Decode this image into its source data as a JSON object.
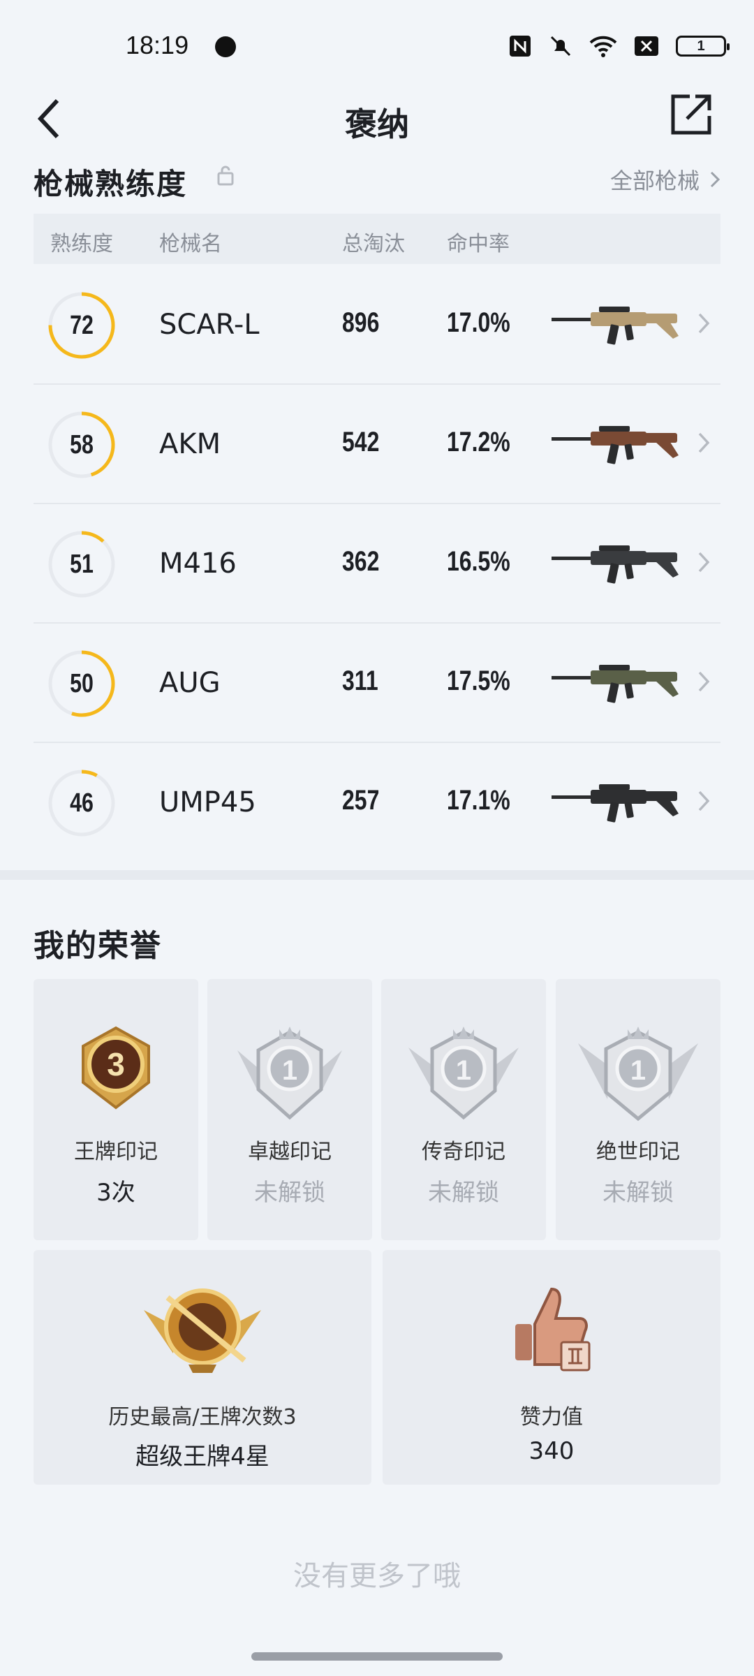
{
  "status_bar": {
    "time": "18:19",
    "battery": "1"
  },
  "header": {
    "title": "褒纳"
  },
  "weapons": {
    "title": "枪械熟练度",
    "see_all": "全部枪械",
    "columns": [
      "熟练度",
      "枪械名",
      "总淘汰",
      "命中率"
    ],
    "rows": [
      {
        "level": "72",
        "progress": 0.75,
        "name": "SCAR-L",
        "kills": "896",
        "accuracy": "17.0%",
        "gun_color": "#b59c73"
      },
      {
        "level": "58",
        "progress": 0.45,
        "name": "AKM",
        "kills": "542",
        "accuracy": "17.2%",
        "gun_color": "#7a4a34"
      },
      {
        "level": "51",
        "progress": 0.12,
        "name": "M416",
        "kills": "362",
        "accuracy": "16.5%",
        "gun_color": "#3a3c3f"
      },
      {
        "level": "50",
        "progress": 0.55,
        "name": "AUG",
        "kills": "311",
        "accuracy": "17.5%",
        "gun_color": "#5a6048"
      },
      {
        "level": "46",
        "progress": 0.08,
        "name": "UMP45",
        "kills": "257",
        "accuracy": "17.1%",
        "gun_color": "#2e2f31"
      }
    ]
  },
  "honors": {
    "title": "我的荣誉",
    "badges": [
      {
        "icon": "ace-badge-icon",
        "label": "王牌印记",
        "value": "3次",
        "number": "3"
      },
      {
        "icon": "excellence-badge-icon",
        "label": "卓越印记",
        "value": "未解锁",
        "number": "1"
      },
      {
        "icon": "legend-badge-icon",
        "label": "传奇印记",
        "value": "未解锁",
        "number": "1"
      },
      {
        "icon": "peerless-badge-icon",
        "label": "绝世印记",
        "value": "未解锁",
        "number": "1"
      }
    ],
    "highest": {
      "label": "历史最高/王牌次数3",
      "value": "超级王牌4星"
    },
    "likes": {
      "label": "赞力值",
      "value": "340"
    }
  },
  "footer": {
    "end_text": "没有更多了哦"
  },
  "colors": {
    "accent": "#f5b81b",
    "ring_track": "#e6e9ee"
  }
}
